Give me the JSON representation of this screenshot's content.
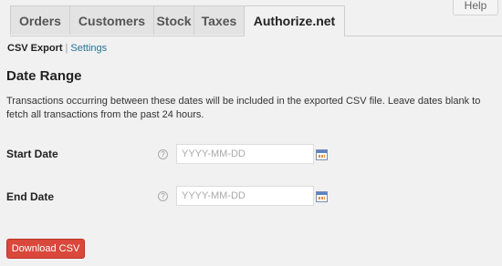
{
  "help": {
    "label": "Help"
  },
  "tabs": [
    {
      "label": "Orders",
      "active": false
    },
    {
      "label": "Customers",
      "active": false
    },
    {
      "label": "Stock",
      "active": false
    },
    {
      "label": "Taxes",
      "active": false
    },
    {
      "label": "Authorize.net",
      "active": true
    }
  ],
  "subnav": {
    "current": "CSV Export",
    "separator": "|",
    "settings_link": "Settings"
  },
  "section": {
    "title": "Date Range",
    "description": "Transactions occurring between these dates will be included in the exported CSV file. Leave dates blank to fetch all transactions from the past 24 hours."
  },
  "fields": {
    "start": {
      "label": "Start Date",
      "placeholder": "YYYY-MM-DD",
      "value": "",
      "help_icon": "question-circle-icon",
      "calendar_icon": "calendar-icon"
    },
    "end": {
      "label": "End Date",
      "placeholder": "YYYY-MM-DD",
      "value": "",
      "help_icon": "question-circle-icon",
      "calendar_icon": "calendar-icon"
    }
  },
  "download_button": {
    "label": "Download CSV"
  },
  "colors": {
    "accent_button": "#d9483b",
    "link": "#21759b",
    "background": "#f1f1f1"
  }
}
